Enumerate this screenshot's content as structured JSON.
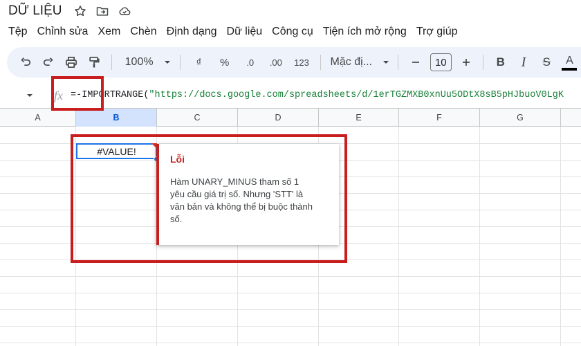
{
  "document": {
    "title": "DỮ LIỆU"
  },
  "menu": {
    "items": [
      "Tệp",
      "Chỉnh sửa",
      "Xem",
      "Chèn",
      "Định dạng",
      "Dữ liệu",
      "Công cụ",
      "Tiện ích mở rộng",
      "Trợ giúp"
    ]
  },
  "toolbar": {
    "zoom": "100%",
    "currency_label": "₫",
    "percent_label": "%",
    "decrease_decimal_label": ".0",
    "increase_decimal_label": ".00",
    "number_format_label": "123",
    "font_name": "Mặc đị...",
    "font_size": "10",
    "bold_label": "B",
    "italic_label": "I",
    "strike_label": "S",
    "text_color_label": "A",
    "text_color_value": "#000000"
  },
  "formula_bar": {
    "fx_label": "fx",
    "formula_prefix": "=-IMPORTRANGE(",
    "formula_string": "\"https://docs.google.com/spreadsheets/d/1erTGZMXB0xnUu5ODtX8sB5pHJbuoV0LgK"
  },
  "grid": {
    "columns": [
      "A",
      "B",
      "C",
      "D",
      "E",
      "F",
      "G"
    ],
    "selected_column": "B",
    "selected_cell_value": "#VALUE!"
  },
  "error_popup": {
    "title": "Lỗi",
    "message": "Hàm UNARY_MINUS tham số 1 yêu cầu giá trị số. Nhưng 'STT' là văn bản và không thể bị buộc thành số."
  },
  "colors": {
    "toolbar_bg": "#eef2fb",
    "selection": "#1a73e8",
    "error": "#c5221f",
    "annotation": "#c81e1e"
  }
}
